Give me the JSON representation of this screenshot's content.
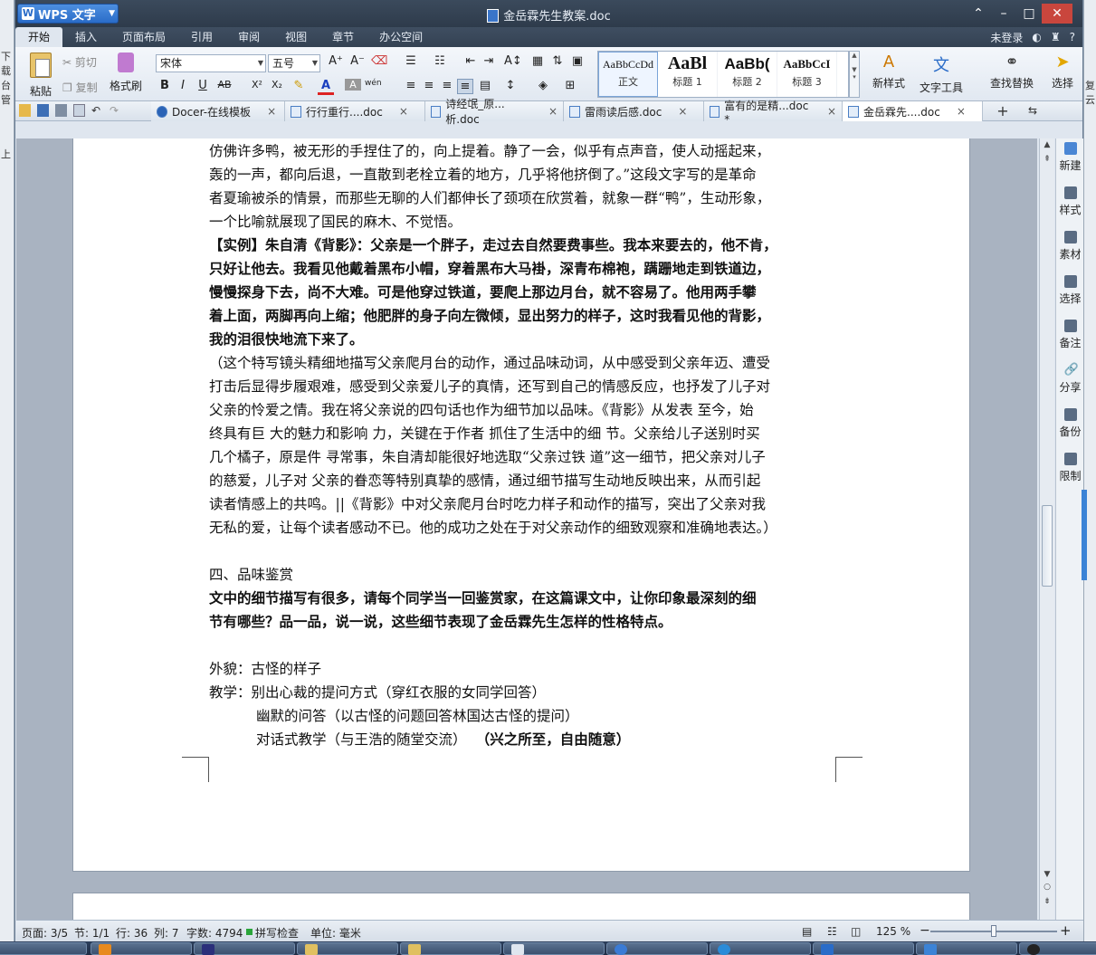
{
  "app": {
    "name": "WPS 文字",
    "doc_title": "金岳霖先生教案.doc"
  },
  "menu": {
    "tabs": [
      "开始",
      "插入",
      "页面布局",
      "引用",
      "审阅",
      "视图",
      "章节",
      "办公空间"
    ],
    "login": "未登录"
  },
  "ribbon": {
    "paste": "粘贴",
    "cut": "剪切",
    "copy": "复制",
    "format_painter": "格式刷",
    "font_name": "宋体",
    "font_size": "五号",
    "styles": [
      {
        "sample": "AaBbCcDd",
        "name": "正文"
      },
      {
        "sample": "AaBl",
        "name": "标题 1"
      },
      {
        "sample": "AaBb(",
        "name": "标题 2"
      },
      {
        "sample": "AaBbCcI",
        "name": "标题 3"
      }
    ],
    "new_style": "新样式",
    "text_tools": "文字工具",
    "find_replace": "查找替换",
    "select": "选择"
  },
  "doc_tabs": [
    {
      "label": "Docer-在线模板",
      "active": false
    },
    {
      "label": "行行重行....doc",
      "active": false
    },
    {
      "label": "诗经氓_原...析.doc",
      "active": false
    },
    {
      "label": "雷雨读后感.doc",
      "active": false
    },
    {
      "label": "富有的是精...doc *",
      "active": false
    },
    {
      "label": "金岳霖先....doc",
      "active": true
    }
  ],
  "document": {
    "lines": [
      {
        "t": "仿佛许多鸭，被无形的手捏住了的，向上提着。静了一会，似乎有点声音，使人动摇起来，",
        "s": ""
      },
      {
        "t": "轰的一声，都向后退，一直散到老栓立着的地方，几乎将他挤倒了。”这段文字写的是革命",
        "s": ""
      },
      {
        "t": "者夏瑜被杀的情景，而那些无聊的人们都伸长了颈项在欣赏着，就象一群“鸭”，生动形象，",
        "s": ""
      },
      {
        "t": "一个比喻就展现了国民的麻木、不觉悟。",
        "s": ""
      },
      {
        "t": "【实例】朱自清《背影》：父亲是一个胖子，走过去自然要费事些。我本来要去的，他不肯，",
        "s": "b"
      },
      {
        "t": "只好让他去。我看见他戴着黑布小帽，穿着黑布大马褂，深青布棉袍，蹒跚地走到铁道边，",
        "s": "b"
      },
      {
        "t": "慢慢探身下去，尚不大难。可是他穿过铁道，要爬上那边月台，就不容易了。他用两手攀",
        "s": "b"
      },
      {
        "t": "着上面，两脚再向上缩；他肥胖的身子向左微倾，显出努力的样子，这时我看见他的背影，",
        "s": "b"
      },
      {
        "t": "我的泪很快地流下来了。",
        "s": "b"
      },
      {
        "t": "（这个特写镜头精细地描写父亲爬月台的动作，通过品味动词，从中感受到父亲年迈、遭受",
        "s": ""
      },
      {
        "t": "打击后显得步履艰难，感受到父亲爱儿子的真情，还写到自己的情感反应，也抒发了儿子对",
        "s": ""
      },
      {
        "t": "父亲的怜爱之情。我在将父亲说的四句话也作为细节加以品味。《背影》从发表  至今，始",
        "s": ""
      },
      {
        "t": "终具有巨  大的魅力和影响  力，关键在于作者  抓住了生活中的细  节。父亲给儿子送别时买",
        "s": ""
      },
      {
        "t": "几个橘子，原是件  寻常事，朱自清却能很好地选取“父亲过铁  道”这一细节，把父亲对儿子",
        "s": ""
      },
      {
        "t": "的慈爱，儿子对  父亲的眷恋等特别真挚的感情，通过细节描写生动地反映出来，从而引起",
        "s": ""
      },
      {
        "t": "读者情感上的共鸣。||《背影》中对父亲爬月台时吃力样子和动作的描写，突出了父亲对我",
        "s": ""
      },
      {
        "t": "无私的爱，让每个读者感动不已。他的成功之处在于对父亲动作的细致观察和准确地表达。）",
        "s": ""
      },
      {
        "t": "",
        "s": "gap"
      },
      {
        "t": "四、品味鉴赏",
        "s": ""
      },
      {
        "t": "文中的细节描写有很多，请每个同学当一回鉴赏家，在这篇课文中，让你印象最深刻的细",
        "s": "b"
      },
      {
        "t": "节有哪些？品一品，说一说，这些细节表现了金岳霖先生怎样的性格特点。",
        "s": "b"
      },
      {
        "t": "",
        "s": "gap"
      },
      {
        "t": "外貌：古怪的样子",
        "s": ""
      },
      {
        "t": "教学：别出心裁的提问方式（穿红衣服的女同学回答）",
        "s": ""
      },
      {
        "t": "幽默的问答（以古怪的问题回答林国达古怪的提问）",
        "s": "ind"
      },
      {
        "t": "对话式教学（与王浩的随堂交流）",
        "s": "ind",
        "suffix": "（兴之所至，自由随意）"
      }
    ]
  },
  "side_panel": [
    "新建",
    "样式",
    "素材",
    "选择",
    "备注",
    "分享",
    "备份",
    "限制"
  ],
  "status": {
    "page": "页面: 3/5",
    "section": "节: 1/1",
    "row": "行: 36",
    "col": "列: 7",
    "words": "字数: 4794",
    "spell": "拼写检查",
    "unit": "单位: 毫米",
    "zoom": "125 %"
  },
  "bg_window": {
    "left_labels": [
      "下载",
      "台管",
      "上"
    ],
    "right_labels": [
      "复云"
    ]
  },
  "colors": {
    "accent": "#2a6cc8",
    "titlebar": "#3b4a5c"
  }
}
